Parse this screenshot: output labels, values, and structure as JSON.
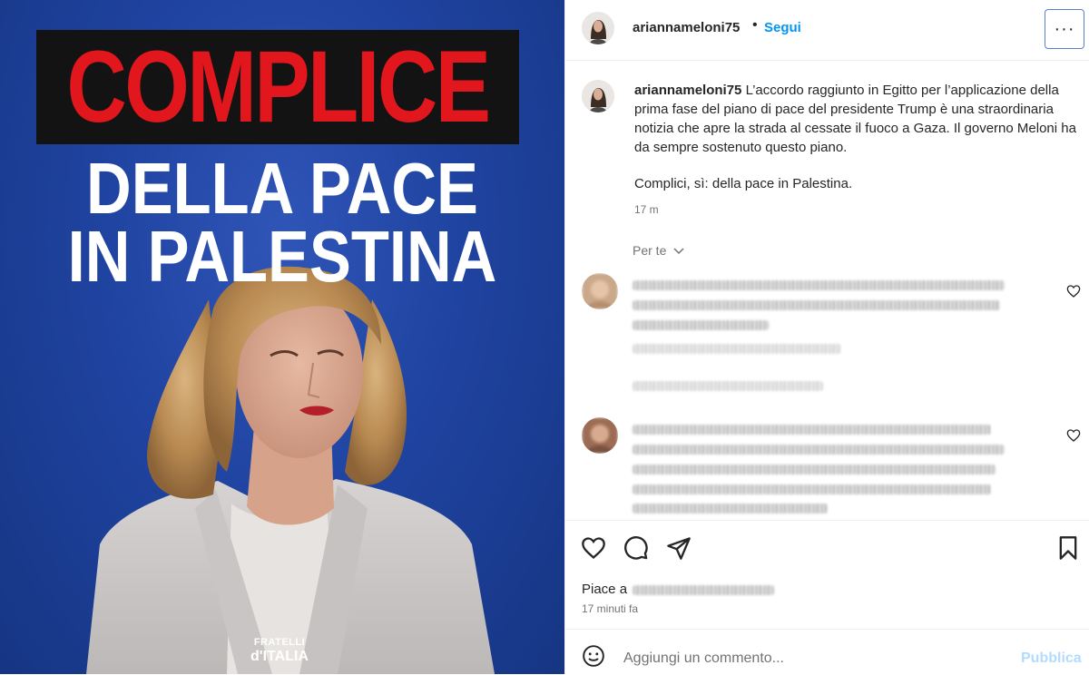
{
  "post": {
    "headline_red": "COMPLICE",
    "headline_line2": "DELLA PACE",
    "headline_line3": "IN PALESTINA",
    "brand_line1": "FRATELLI",
    "brand_line2": "d'ITALIA"
  },
  "header": {
    "username": "ariannameloni75",
    "separator": "•",
    "follow_label": "Segui",
    "more_label": "···"
  },
  "caption": {
    "username": "ariannameloni75",
    "text": "L’accordo raggiunto in Egitto per l’applicazione della prima fase del piano di pace del presidente Trump è una straordinaria notizia che apre la strada al cessate il fuoco a Gaza. Il governo Meloni ha da sempre sostenuto questo piano.",
    "text_2": "Complici, sì: della pace in Palestina.",
    "time": "17 m",
    "translate_label": "Per te",
    "translate_chevron": "chevron-down-icon"
  },
  "comments": [
    {
      "blurred": true
    },
    {
      "blurred": true
    }
  ],
  "actions": {
    "likes_prefix": "Piace a",
    "time_ago": "17 minuti fa"
  },
  "add_comment": {
    "placeholder": "Aggiungi un commento...",
    "publish_label": "Pubblica"
  },
  "colors": {
    "accent": "#0095f6",
    "publish_disabled": "#b3dbff",
    "headline_red": "#e2161d",
    "background_blue": "#1f43a0"
  }
}
